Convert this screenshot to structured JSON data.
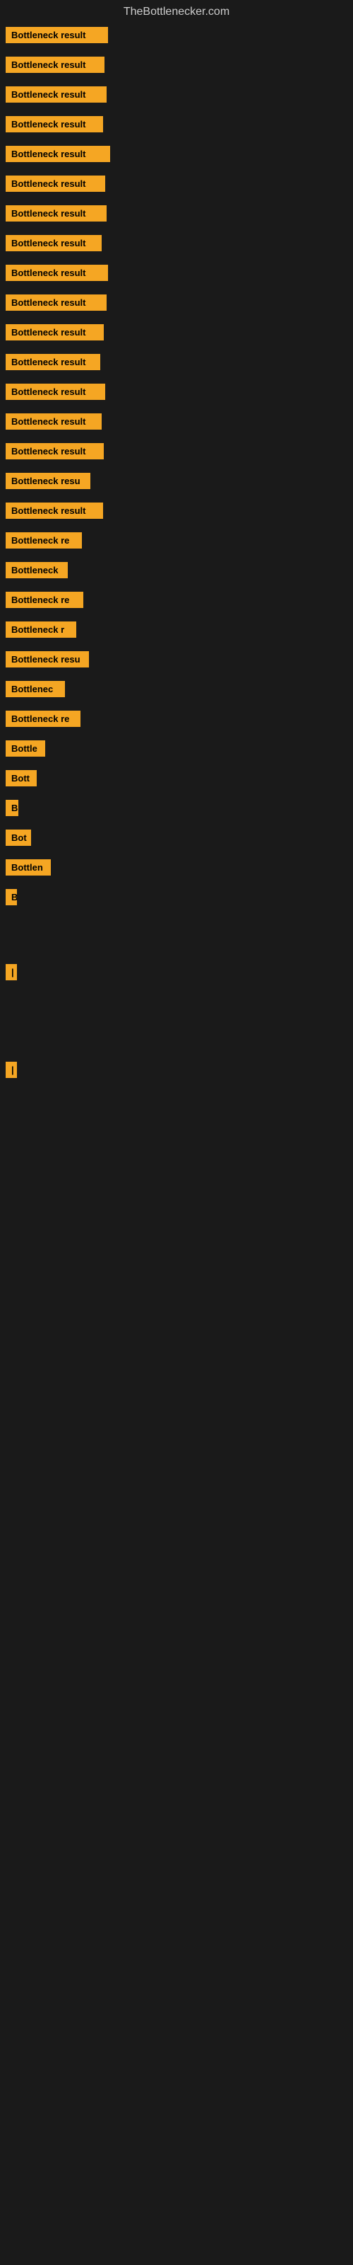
{
  "site": {
    "title": "TheBottlenecker.com"
  },
  "bars": [
    {
      "label": "Bottleneck result",
      "width": 145
    },
    {
      "label": "Bottleneck result",
      "width": 140
    },
    {
      "label": "Bottleneck result",
      "width": 143
    },
    {
      "label": "Bottleneck result",
      "width": 138
    },
    {
      "label": "Bottleneck result",
      "width": 148
    },
    {
      "label": "Bottleneck result",
      "width": 141
    },
    {
      "label": "Bottleneck result",
      "width": 143
    },
    {
      "label": "Bottleneck result",
      "width": 136
    },
    {
      "label": "Bottleneck result",
      "width": 145
    },
    {
      "label": "Bottleneck result",
      "width": 143
    },
    {
      "label": "Bottleneck result",
      "width": 139
    },
    {
      "label": "Bottleneck result",
      "width": 134
    },
    {
      "label": "Bottleneck result",
      "width": 141
    },
    {
      "label": "Bottleneck result",
      "width": 136
    },
    {
      "label": "Bottleneck result",
      "width": 139
    },
    {
      "label": "Bottleneck resu",
      "width": 120
    },
    {
      "label": "Bottleneck result",
      "width": 138
    },
    {
      "label": "Bottleneck re",
      "width": 108
    },
    {
      "label": "Bottleneck",
      "width": 88
    },
    {
      "label": "Bottleneck re",
      "width": 110
    },
    {
      "label": "Bottleneck r",
      "width": 100
    },
    {
      "label": "Bottleneck resu",
      "width": 118
    },
    {
      "label": "Bottlenec",
      "width": 84
    },
    {
      "label": "Bottleneck re",
      "width": 106
    },
    {
      "label": "Bottle",
      "width": 56
    },
    {
      "label": "Bott",
      "width": 44
    },
    {
      "label": "B",
      "width": 18
    },
    {
      "label": "Bot",
      "width": 36
    },
    {
      "label": "Bottlen",
      "width": 64
    },
    {
      "label": "B",
      "width": 16
    },
    {
      "label": "",
      "width": 0
    },
    {
      "label": "",
      "width": 0
    },
    {
      "label": "|",
      "width": 10
    },
    {
      "label": "",
      "width": 0
    },
    {
      "label": "",
      "width": 0
    },
    {
      "label": "",
      "width": 0
    },
    {
      "label": "|",
      "width": 10
    }
  ]
}
